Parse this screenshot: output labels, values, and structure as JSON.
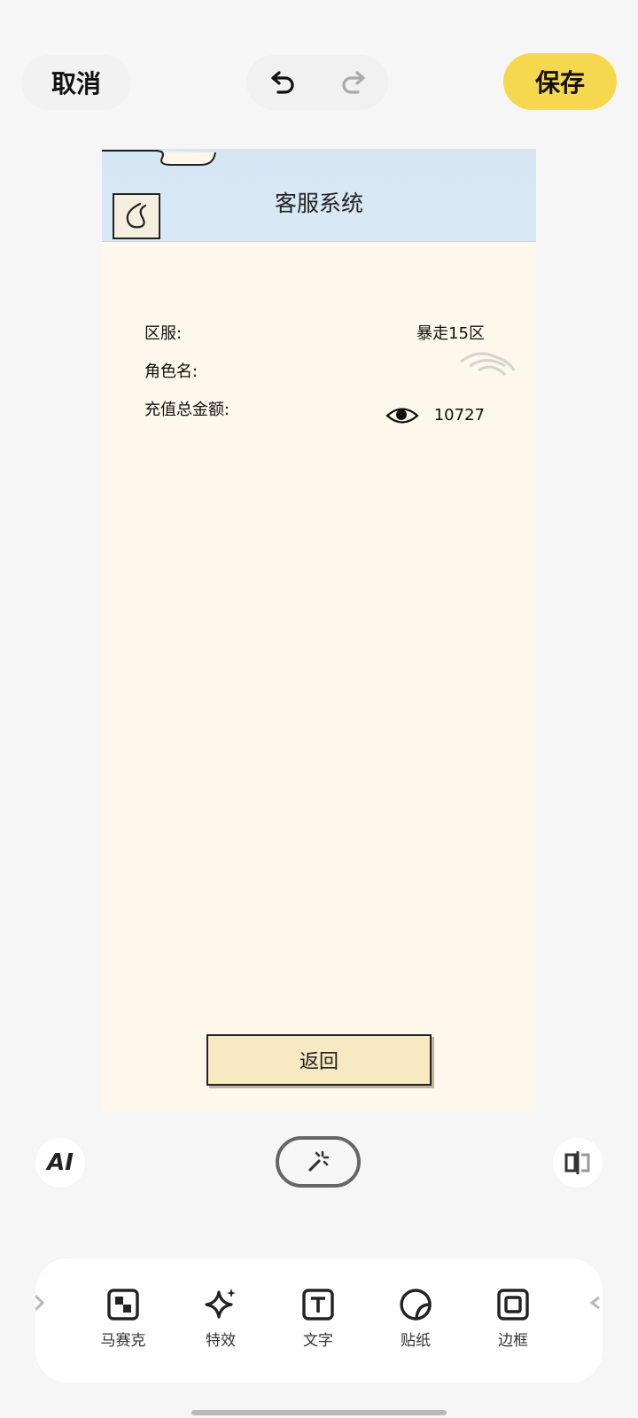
{
  "topbar": {
    "cancel_label": "取消",
    "save_label": "保存",
    "undo_icon": "undo-icon",
    "redo_icon": "redo-icon"
  },
  "canvas": {
    "title": "客服系统",
    "rows": [
      {
        "label": "区服:",
        "value": "暴走15区"
      },
      {
        "label": "角色名:",
        "value": ""
      },
      {
        "label": "充值总金额:",
        "value": "10727"
      }
    ],
    "return_label": "返回"
  },
  "tools_row": {
    "ai_label": "AI",
    "magic_icon": "magic-wand-icon",
    "compare_icon": "compare-icon"
  },
  "toolbar": {
    "items": [
      {
        "label": "马赛克",
        "icon": "mosaic-icon"
      },
      {
        "label": "特效",
        "icon": "sparkle-icon"
      },
      {
        "label": "文字",
        "icon": "text-icon"
      },
      {
        "label": "贴纸",
        "icon": "sticker-icon"
      },
      {
        "label": "边框",
        "icon": "frame-icon"
      }
    ]
  },
  "colors": {
    "accent": "#f6d84e",
    "canvas_bg": "#fdf7ec",
    "header_bg": "#d6e6f3",
    "button_bg": "#f7e9c1"
  }
}
